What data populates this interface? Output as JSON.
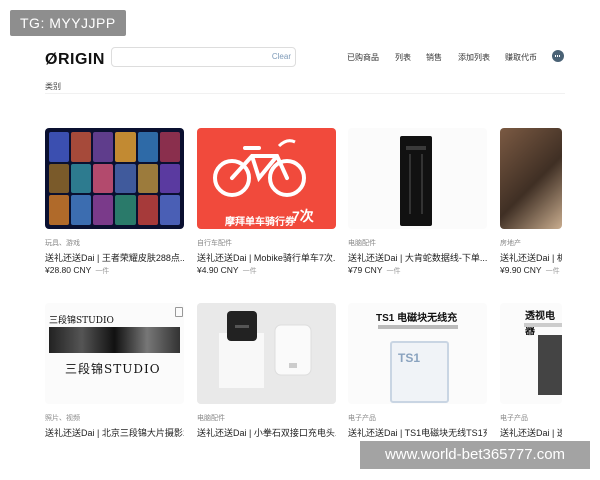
{
  "tag": "TG: MYYJJPP",
  "header": {
    "logo": "ØRIGIN",
    "search_placeholder": "",
    "clear_label": "Clear",
    "nav": [
      "已购商品",
      "列表",
      "销售",
      "添加列表",
      "赚取代币"
    ]
  },
  "category_label": "类别",
  "products": [
    {
      "category": "玩具、游戏",
      "title": "送礼还送Dai | 王者荣耀皮肤288点...",
      "price": "¥28.80 CNY",
      "unit": "一件"
    },
    {
      "category": "自行车配件",
      "title": "送礼还送Dai | Mobike骑行单车7次...",
      "price": "¥4.90 CNY",
      "unit": "一件",
      "image_text": "摩拜单车骑行券",
      "image_badge": "7次"
    },
    {
      "category": "电脑配件",
      "title": "送礼还送Dai | 大肯蛇数据线-下单...",
      "price": "¥79 CNY",
      "unit": "一件"
    },
    {
      "category": "房地产",
      "title": "送礼还送Dai | 机",
      "price": "¥9.90 CNY",
      "unit": "一件"
    },
    {
      "category": "照片、视频",
      "title": "送礼还送Dai | 北京三段锦大片摄影1...",
      "price": "",
      "unit": "",
      "image_text": "三段锦STUDIO",
      "image_text_2": "三段锦STUDIO"
    },
    {
      "category": "电脑配件",
      "title": "送礼还送Dai | 小拳石双接口充电头...",
      "price": "",
      "unit": ""
    },
    {
      "category": "电子产品",
      "title": "送礼还送Dai | TS1电磁块无线TS1充电...",
      "price": "",
      "unit": "",
      "image_text": "TS1 电磁块无线充"
    },
    {
      "category": "电子产品",
      "title": "送礼还送Dai | 透",
      "price": "",
      "unit": "",
      "image_text": "透视电器"
    }
  ],
  "watermark": "www.world-bet365777.com",
  "colors": {
    "accent": "#f14a3c",
    "watermark_bg": "#a3a3a3",
    "tag_bg": "#8e8e8e"
  }
}
